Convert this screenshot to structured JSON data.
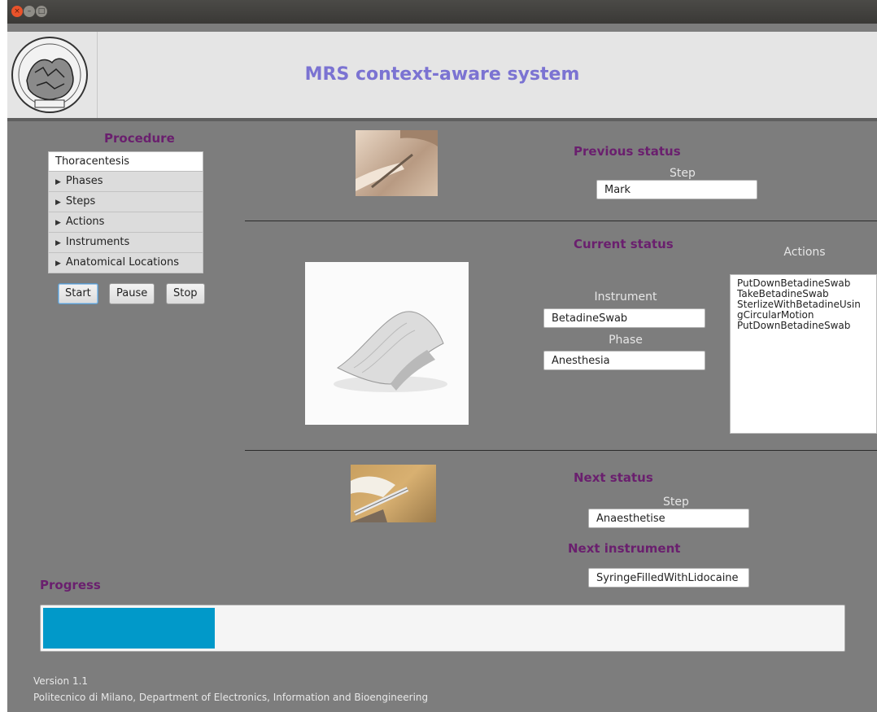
{
  "header": {
    "title": "MRS context-aware system",
    "logo_text": "POLITECNICO MILANO"
  },
  "procedure": {
    "heading": "Procedure",
    "root": "Thoracentesis",
    "nodes": [
      "Phases",
      "Steps",
      "Actions",
      "Instruments",
      "Anatomical Locations"
    ]
  },
  "controls": {
    "start": "Start",
    "pause": "Pause",
    "stop": "Stop"
  },
  "previous": {
    "heading": "Previous status",
    "step_label": "Step",
    "step_value": "Mark"
  },
  "current": {
    "heading": "Current status",
    "instrument_label": "Instrument",
    "instrument_value": "BetadineSwab",
    "phase_label": "Phase",
    "phase_value": "Anesthesia",
    "actions_label": "Actions",
    "actions": [
      "PutDownBetadineSwab",
      "TakeBetadineSwab",
      "SterlizeWithBetadineUsin",
      "gCircularMotion",
      "PutDownBetadineSwab"
    ]
  },
  "next": {
    "heading": "Next status",
    "step_label": "Step",
    "step_value": "Anaesthetise",
    "instrument_heading": "Next instrument",
    "instrument_value": "SyringeFilledWithLidocaine"
  },
  "progress": {
    "label": "Progress",
    "value_percent": 21.5
  },
  "footer": {
    "version": "Version 1.1",
    "org": "Politecnico di Milano, Department of Electronics, Information and Bioengineering"
  },
  "colors": {
    "accent": "#6a1f6e",
    "title": "#7b73d2",
    "progress_fill": "#0199c9",
    "background": "#7d7d7d"
  }
}
